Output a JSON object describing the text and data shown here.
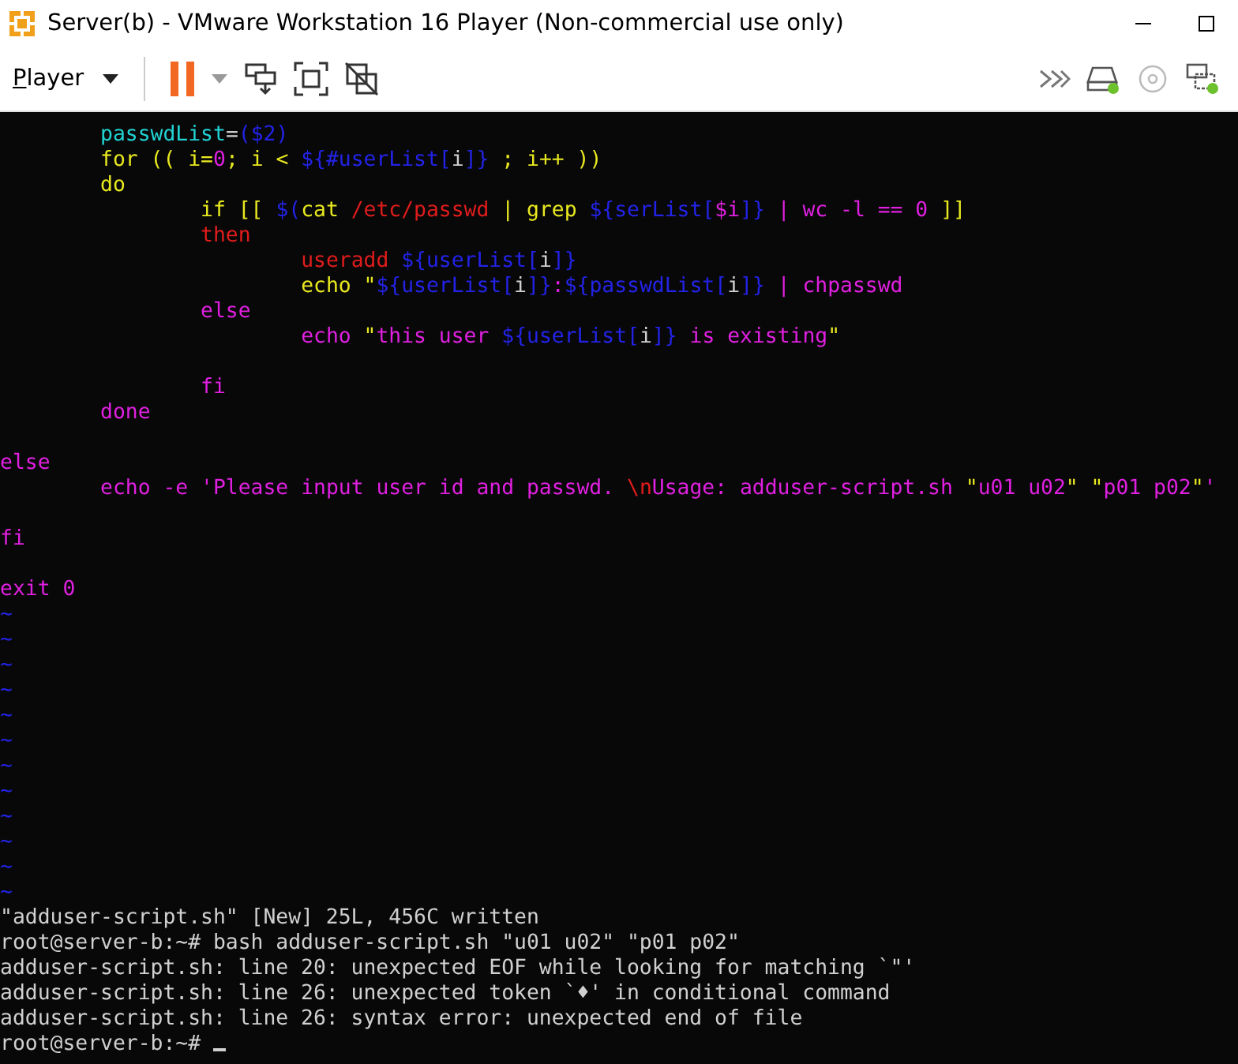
{
  "window": {
    "title": "Server(b) - VMware Workstation 16 Player (Non-commercial use only)"
  },
  "toolbar": {
    "menu": "Player",
    "paused": true
  },
  "terminal": {
    "lines": [
      {
        "kind": "code",
        "segments": [
          {
            "text": "\tpasswdList",
            "color": "#22d3d3"
          },
          {
            "text": "=",
            "color": "#d0d0d0"
          },
          {
            "text": "($2)",
            "color": "#2323e8"
          }
        ]
      },
      {
        "kind": "code",
        "segments": [
          {
            "text": "\tfor (( i=",
            "color": "#e8e820"
          },
          {
            "text": "0",
            "color": "#e020e0"
          },
          {
            "text": "; i < ",
            "color": "#e8e820"
          },
          {
            "text": "${#userList[",
            "color": "#2323e8"
          },
          {
            "text": "i",
            "color": "#d0d0d0"
          },
          {
            "text": "]}",
            "color": "#2323e8"
          },
          {
            "text": " ; i++ ))",
            "color": "#e8e820"
          }
        ]
      },
      {
        "kind": "code",
        "segments": [
          {
            "text": "\tdo",
            "color": "#e8e820"
          }
        ]
      },
      {
        "kind": "code",
        "segments": [
          {
            "text": "\t\tif [[ ",
            "color": "#e8e820"
          },
          {
            "text": "$(",
            "color": "#2323e8"
          },
          {
            "text": "cat ",
            "color": "#e8e820"
          },
          {
            "text": "/etc/passwd",
            "color": "#e01c1c"
          },
          {
            "text": " | grep ",
            "color": "#e8e820"
          },
          {
            "text": "${serList[",
            "color": "#2323e8"
          },
          {
            "text": "$i",
            "color": "#e020e0"
          },
          {
            "text": "]}",
            "color": "#2323e8"
          },
          {
            "text": " | wc -l == 0",
            "color": "#e020e0"
          },
          {
            "text": " ]]",
            "color": "#e8e820"
          }
        ]
      },
      {
        "kind": "code",
        "segments": [
          {
            "text": "\t\tthen",
            "color": "#e01c1c"
          }
        ]
      },
      {
        "kind": "code",
        "segments": [
          {
            "text": "\t\t\tuseradd ",
            "color": "#e01c1c"
          },
          {
            "text": "${userList[",
            "color": "#2323e8"
          },
          {
            "text": "i",
            "color": "#d0d0d0"
          },
          {
            "text": "]}",
            "color": "#2323e8"
          }
        ]
      },
      {
        "kind": "code",
        "segments": [
          {
            "text": "\t\t\techo \"",
            "color": "#e8e820"
          },
          {
            "text": "${userList[",
            "color": "#2323e8"
          },
          {
            "text": "i",
            "color": "#d0d0d0"
          },
          {
            "text": "]}",
            "color": "#2323e8"
          },
          {
            "text": ":",
            "color": "#e020e0"
          },
          {
            "text": "${passwdList[",
            "color": "#2323e8"
          },
          {
            "text": "i",
            "color": "#d0d0d0"
          },
          {
            "text": "]}",
            "color": "#2323e8"
          },
          {
            "text": " | chpasswd",
            "color": "#e020e0"
          }
        ]
      },
      {
        "kind": "code",
        "segments": [
          {
            "text": "\t\telse",
            "color": "#e020e0"
          }
        ]
      },
      {
        "kind": "code",
        "segments": [
          {
            "text": "\t\t\techo ",
            "color": "#e020e0"
          },
          {
            "text": "\"",
            "color": "#e8e820"
          },
          {
            "text": "this user ",
            "color": "#e020e0"
          },
          {
            "text": "${userList[",
            "color": "#2323e8"
          },
          {
            "text": "i",
            "color": "#d0d0d0"
          },
          {
            "text": "]}",
            "color": "#2323e8"
          },
          {
            "text": " is existing",
            "color": "#e020e0"
          },
          {
            "text": "\"",
            "color": "#e8e820"
          }
        ]
      },
      {
        "kind": "blank"
      },
      {
        "kind": "code",
        "segments": [
          {
            "text": "\t\tfi",
            "color": "#e020e0"
          }
        ]
      },
      {
        "kind": "code",
        "segments": [
          {
            "text": "\tdone",
            "color": "#e020e0"
          }
        ]
      },
      {
        "kind": "blank"
      },
      {
        "kind": "code",
        "segments": [
          {
            "text": "else",
            "color": "#e020e0"
          }
        ]
      },
      {
        "kind": "code",
        "segments": [
          {
            "text": "\techo -e 'Please input user id and passwd. ",
            "color": "#e020e0"
          },
          {
            "text": "\\n",
            "color": "#e01c1c"
          },
          {
            "text": "Usage: adduser-script.sh ",
            "color": "#e020e0"
          },
          {
            "text": "\"",
            "color": "#e8e820"
          },
          {
            "text": "u01 u02",
            "color": "#e020e0"
          },
          {
            "text": "\" \"",
            "color": "#e8e820"
          },
          {
            "text": "p01 p02",
            "color": "#e020e0"
          },
          {
            "text": "\"",
            "color": "#e8e820"
          },
          {
            "text": "'",
            "color": "#e020e0"
          }
        ]
      },
      {
        "kind": "blank"
      },
      {
        "kind": "code",
        "segments": [
          {
            "text": "fi",
            "color": "#e020e0"
          }
        ]
      },
      {
        "kind": "blank"
      },
      {
        "kind": "code",
        "segments": [
          {
            "text": "exit 0",
            "color": "#e020e0"
          }
        ]
      },
      {
        "kind": "code",
        "segments": [
          {
            "text": "~",
            "color": "#2323e8"
          }
        ]
      },
      {
        "kind": "code",
        "segments": [
          {
            "text": "~",
            "color": "#2323e8"
          }
        ]
      },
      {
        "kind": "code",
        "segments": [
          {
            "text": "~",
            "color": "#2323e8"
          }
        ]
      },
      {
        "kind": "code",
        "segments": [
          {
            "text": "~",
            "color": "#2323e8"
          }
        ]
      },
      {
        "kind": "code",
        "segments": [
          {
            "text": "~",
            "color": "#2323e8"
          }
        ]
      },
      {
        "kind": "code",
        "segments": [
          {
            "text": "~",
            "color": "#2323e8"
          }
        ]
      },
      {
        "kind": "code",
        "segments": [
          {
            "text": "~",
            "color": "#2323e8"
          }
        ]
      },
      {
        "kind": "code",
        "segments": [
          {
            "text": "~",
            "color": "#2323e8"
          }
        ]
      },
      {
        "kind": "code",
        "segments": [
          {
            "text": "~",
            "color": "#2323e8"
          }
        ]
      },
      {
        "kind": "code",
        "segments": [
          {
            "text": "~",
            "color": "#2323e8"
          }
        ]
      },
      {
        "kind": "code",
        "segments": [
          {
            "text": "~",
            "color": "#2323e8"
          }
        ]
      },
      {
        "kind": "code",
        "segments": [
          {
            "text": "~",
            "color": "#2323e8"
          }
        ]
      },
      {
        "kind": "code",
        "segments": [
          {
            "text": "\"adduser-script.sh\" [New] 25L, 456C written",
            "color": "#d0d0d0"
          }
        ]
      },
      {
        "kind": "code",
        "segments": [
          {
            "text": "root@server-b:~# bash adduser-script.sh \"u01 u02\" \"p01 p02\"",
            "color": "#d0d0d0"
          }
        ]
      },
      {
        "kind": "code",
        "segments": [
          {
            "text": "adduser-script.sh: line 20: unexpected EOF while looking for matching `\"'",
            "color": "#d0d0d0"
          }
        ]
      },
      {
        "kind": "code",
        "segments": [
          {
            "text": "adduser-script.sh: line 26: unexpected token `♦' in conditional command",
            "color": "#d0d0d0"
          }
        ]
      },
      {
        "kind": "code",
        "segments": [
          {
            "text": "adduser-script.sh: line 26: syntax error: unexpected end of file",
            "color": "#d0d0d0"
          }
        ]
      },
      {
        "kind": "code",
        "segments": [
          {
            "text": "root@server-b:~# ",
            "color": "#d0d0d0"
          }
        ],
        "cursor": true
      }
    ]
  }
}
